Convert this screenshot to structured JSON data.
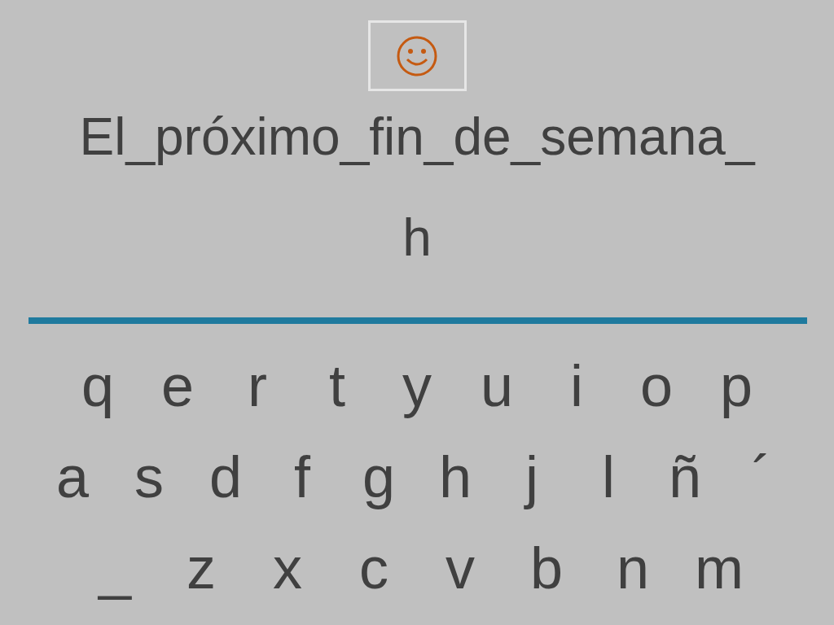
{
  "sentence": "El_próximo_fin_de_semana_",
  "answer": "h",
  "keyboard": {
    "rows": [
      [
        "q",
        "e",
        "r",
        "t",
        "y",
        "u",
        "i",
        "o",
        "p"
      ],
      [
        "a",
        "s",
        "d",
        "f",
        "g",
        "h",
        "j",
        "l",
        "ñ",
        "´"
      ],
      [
        "_",
        "z",
        "x",
        "c",
        "v",
        "b",
        "n",
        "m"
      ]
    ]
  }
}
